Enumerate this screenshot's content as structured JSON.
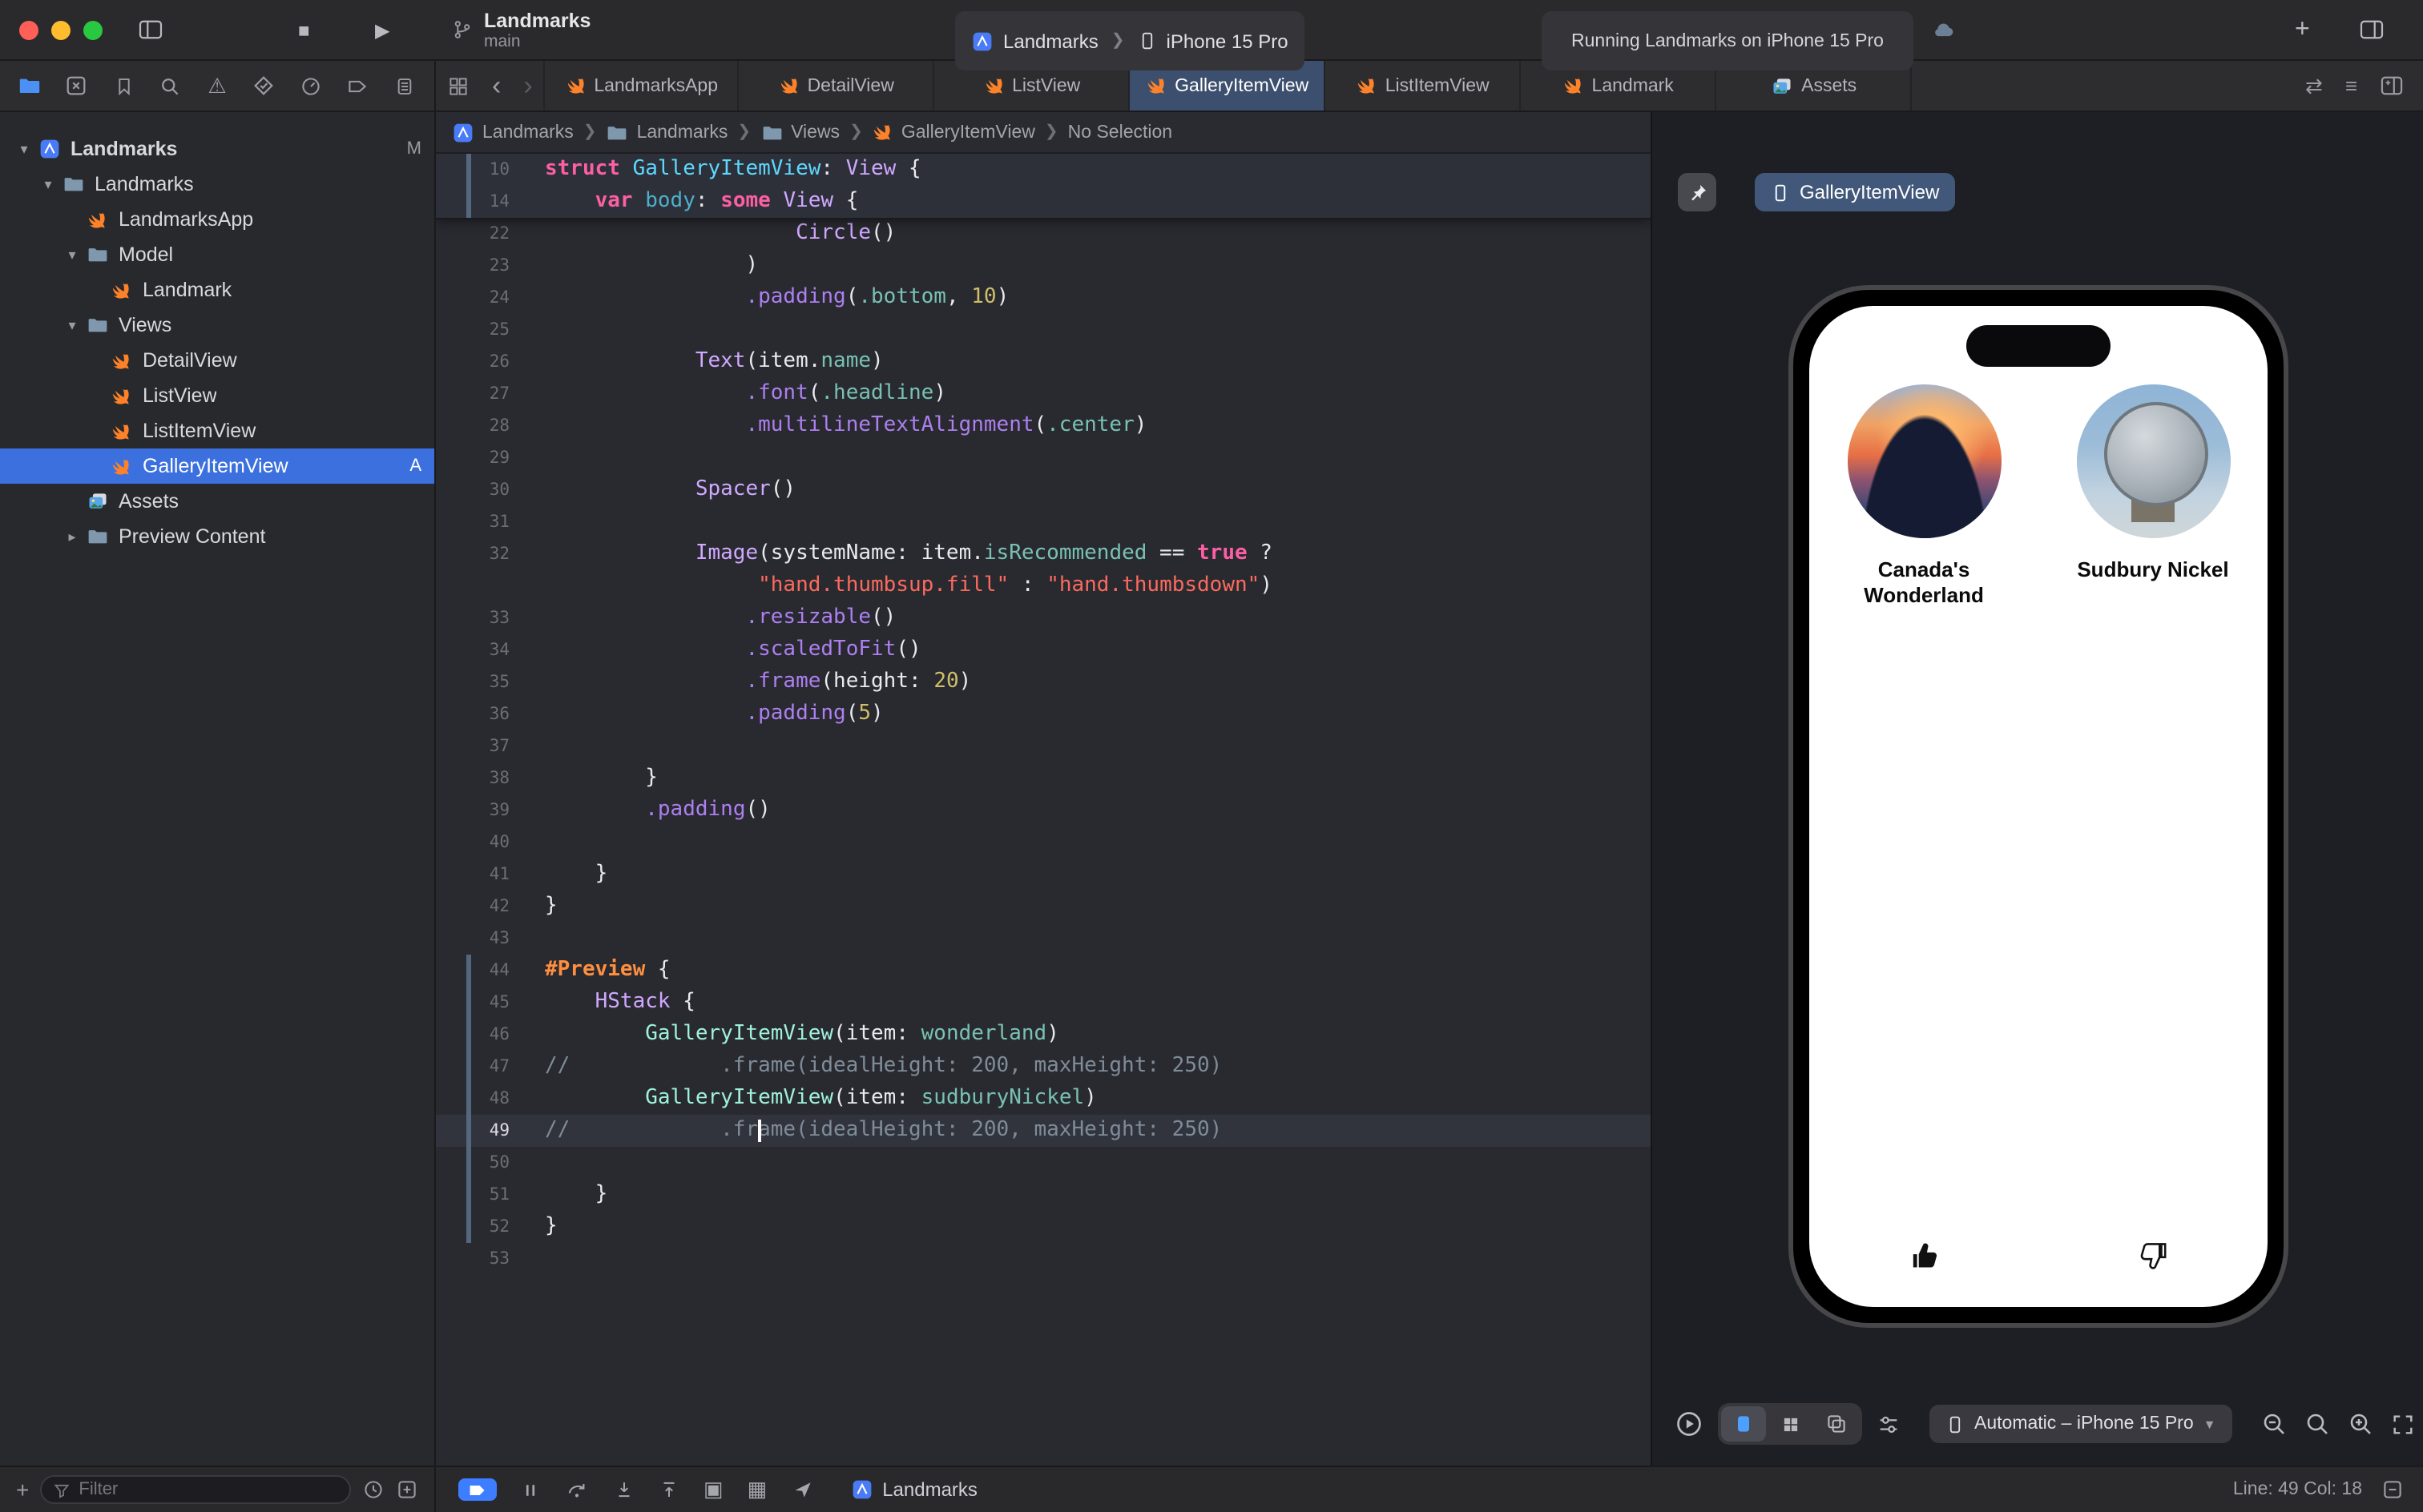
{
  "titlebar": {
    "title": "Landmarks",
    "subtitle": "main",
    "scheme_project": "Landmarks",
    "scheme_device": "iPhone 15 Pro",
    "status": "Running Landmarks on iPhone 15 Pro"
  },
  "navigator": {
    "icons": [
      {
        "name": "project-navigator",
        "icon": "folderC",
        "active": true
      },
      {
        "name": "source-control-navigator",
        "icon": "xsquare"
      },
      {
        "name": "bookmarks-navigator",
        "icon": "bookmark"
      },
      {
        "name": "find-navigator",
        "icon": "search"
      },
      {
        "name": "issues-navigator",
        "icon": "warning"
      },
      {
        "name": "tests-navigator",
        "icon": "diamond"
      },
      {
        "name": "debug-navigator",
        "icon": "gauge"
      },
      {
        "name": "breakpoints-navigator",
        "icon": "tag"
      },
      {
        "name": "reports-navigator",
        "icon": "doclist"
      }
    ]
  },
  "tabs": [
    {
      "label": "LandmarksApp",
      "icon": "swift"
    },
    {
      "label": "DetailView",
      "icon": "swift"
    },
    {
      "label": "ListView",
      "icon": "swift"
    },
    {
      "label": "GalleryItemView",
      "icon": "swift",
      "active": true
    },
    {
      "label": "ListItemView",
      "icon": "swift"
    },
    {
      "label": "Landmark",
      "icon": "swift"
    },
    {
      "label": "Assets",
      "icon": "assets"
    }
  ],
  "breadcrumb": [
    {
      "label": "Landmarks",
      "icon": "app"
    },
    {
      "label": "Landmarks",
      "icon": "folder"
    },
    {
      "label": "Views",
      "icon": "folder"
    },
    {
      "label": "GalleryItemView",
      "icon": "swift"
    },
    {
      "label": "No Selection"
    }
  ],
  "sidebar": {
    "items": [
      {
        "label": "Landmarks",
        "icon": "app",
        "level": 0,
        "chevron": "down",
        "badge": "M",
        "bold": true
      },
      {
        "label": "Landmarks",
        "icon": "folder",
        "level": 1,
        "chevron": "down"
      },
      {
        "label": "LandmarksApp",
        "icon": "swift",
        "level": 2
      },
      {
        "label": "Model",
        "icon": "folder",
        "level": 2,
        "chevron": "down"
      },
      {
        "label": "Landmark",
        "icon": "swift",
        "level": 3
      },
      {
        "label": "Views",
        "icon": "folder",
        "level": 2,
        "chevron": "down"
      },
      {
        "label": "DetailView",
        "icon": "swift",
        "level": 3
      },
      {
        "label": "ListView",
        "icon": "swift",
        "level": 3
      },
      {
        "label": "ListItemView",
        "icon": "swift",
        "level": 3
      },
      {
        "label": "GalleryItemView",
        "icon": "swift",
        "level": 3,
        "selected": true,
        "badge": "A"
      },
      {
        "label": "Assets",
        "icon": "assets",
        "level": 2
      },
      {
        "label": "Preview Content",
        "icon": "folder",
        "level": 2,
        "chevron": "right"
      }
    ],
    "filter_placeholder": "Filter"
  },
  "editor": {
    "sticky_lines": [
      {
        "num": "10",
        "chg": true,
        "segs": [
          [
            "struct ",
            "k"
          ],
          [
            "GalleryItemView",
            "d"
          ],
          [
            ": ",
            "w"
          ],
          [
            "View",
            "t"
          ],
          [
            " {",
            "w"
          ]
        ]
      },
      {
        "num": "14",
        "chg": true,
        "segs": [
          [
            "    ",
            "w"
          ],
          [
            "var",
            "k"
          ],
          [
            " ",
            "w"
          ],
          [
            "body",
            "v"
          ],
          [
            ": ",
            "w"
          ],
          [
            "some",
            "k"
          ],
          [
            " ",
            "w"
          ],
          [
            "View",
            "t"
          ],
          [
            " {",
            "w"
          ]
        ]
      }
    ],
    "lines": [
      {
        "num": "22",
        "segs": [
          [
            "                    ",
            "w"
          ],
          [
            "Circle",
            "t"
          ],
          [
            "()",
            "w"
          ]
        ]
      },
      {
        "num": "23",
        "segs": [
          [
            "                )",
            "w"
          ]
        ]
      },
      {
        "num": "24",
        "segs": [
          [
            "                ",
            "w"
          ],
          [
            ".padding",
            "fn"
          ],
          [
            "(",
            "w"
          ],
          [
            ".bottom",
            "p"
          ],
          [
            ", ",
            "w"
          ],
          [
            "10",
            "n"
          ],
          [
            ")",
            "w"
          ]
        ]
      },
      {
        "num": "25",
        "segs": []
      },
      {
        "num": "26",
        "segs": [
          [
            "            ",
            "w"
          ],
          [
            "Text",
            "t"
          ],
          [
            "(item.",
            "w"
          ],
          [
            "name",
            "p"
          ],
          [
            ")",
            "w"
          ]
        ]
      },
      {
        "num": "27",
        "segs": [
          [
            "                ",
            "w"
          ],
          [
            ".font",
            "fn"
          ],
          [
            "(",
            "w"
          ],
          [
            ".headline",
            "p"
          ],
          [
            ")",
            "w"
          ]
        ]
      },
      {
        "num": "28",
        "segs": [
          [
            "                ",
            "w"
          ],
          [
            ".multilineTextAlignment",
            "fn"
          ],
          [
            "(",
            "w"
          ],
          [
            ".center",
            "p"
          ],
          [
            ")",
            "w"
          ]
        ]
      },
      {
        "num": "29",
        "segs": []
      },
      {
        "num": "30",
        "segs": [
          [
            "            ",
            "w"
          ],
          [
            "Spacer",
            "t"
          ],
          [
            "()",
            "w"
          ]
        ]
      },
      {
        "num": "31",
        "segs": []
      },
      {
        "num": "32",
        "segs": [
          [
            "            ",
            "w"
          ],
          [
            "Image",
            "t"
          ],
          [
            "(systemName: item.",
            "w"
          ],
          [
            "isRecommended",
            "p"
          ],
          [
            " == ",
            "w"
          ],
          [
            "true",
            "k"
          ],
          [
            " ?",
            "w"
          ]
        ]
      },
      {
        "num": "",
        "segs": [
          [
            "                 ",
            "w"
          ],
          [
            "\"hand.thumbsup.fill\"",
            "s"
          ],
          [
            " : ",
            "w"
          ],
          [
            "\"hand.thumbsdown\"",
            "s"
          ],
          [
            ")",
            "w"
          ]
        ]
      },
      {
        "num": "33",
        "segs": [
          [
            "                ",
            "w"
          ],
          [
            ".resizable",
            "fn"
          ],
          [
            "()",
            "w"
          ]
        ]
      },
      {
        "num": "34",
        "segs": [
          [
            "                ",
            "w"
          ],
          [
            ".scaledToFit",
            "fn"
          ],
          [
            "()",
            "w"
          ]
        ]
      },
      {
        "num": "35",
        "segs": [
          [
            "                ",
            "w"
          ],
          [
            ".frame",
            "fn"
          ],
          [
            "(height: ",
            "w"
          ],
          [
            "20",
            "n"
          ],
          [
            ")",
            "w"
          ]
        ]
      },
      {
        "num": "36",
        "segs": [
          [
            "                ",
            "w"
          ],
          [
            ".padding",
            "fn"
          ],
          [
            "(",
            "w"
          ],
          [
            "5",
            "n"
          ],
          [
            ")",
            "w"
          ]
        ]
      },
      {
        "num": "37",
        "segs": []
      },
      {
        "num": "38",
        "segs": [
          [
            "        }",
            "w"
          ]
        ]
      },
      {
        "num": "39",
        "segs": [
          [
            "        ",
            "w"
          ],
          [
            ".padding",
            "fn"
          ],
          [
            "()",
            "w"
          ]
        ]
      },
      {
        "num": "40",
        "segs": []
      },
      {
        "num": "41",
        "segs": [
          [
            "    }",
            "w"
          ]
        ]
      },
      {
        "num": "42",
        "segs": [
          [
            "}",
            "w"
          ]
        ]
      },
      {
        "num": "43",
        "segs": []
      },
      {
        "num": "44",
        "chg": true,
        "segs": [
          [
            "#Preview",
            "m"
          ],
          [
            " {",
            "w"
          ]
        ]
      },
      {
        "num": "45",
        "chg": true,
        "segs": [
          [
            "    ",
            "w"
          ],
          [
            "HStack",
            "t"
          ],
          [
            " {",
            "w"
          ]
        ]
      },
      {
        "num": "46",
        "chg": true,
        "segs": [
          [
            "        ",
            "w"
          ],
          [
            "GalleryItemView",
            "pt"
          ],
          [
            "(item: ",
            "w"
          ],
          [
            "wonderland",
            "p"
          ],
          [
            ")",
            "w"
          ]
        ]
      },
      {
        "num": "47",
        "chg": true,
        "segs": [
          [
            "//            .frame(idealHeight: 200, maxHeight: 250)",
            "c"
          ]
        ]
      },
      {
        "num": "48",
        "chg": true,
        "segs": [
          [
            "        ",
            "w"
          ],
          [
            "GalleryItemView",
            "pt"
          ],
          [
            "(item: ",
            "w"
          ],
          [
            "sudburyNickel",
            "p"
          ],
          [
            ")",
            "w"
          ]
        ]
      },
      {
        "num": "49",
        "chg": true,
        "cur": true,
        "segs": [
          [
            "//            .frame(idealHeight: 200, maxHeight: 250)",
            "c"
          ]
        ]
      },
      {
        "num": "50",
        "chg": true,
        "segs": []
      },
      {
        "num": "51",
        "chg": true,
        "segs": [
          [
            "    }",
            "w"
          ]
        ]
      },
      {
        "num": "52",
        "chg": true,
        "segs": [
          [
            "}",
            "w"
          ]
        ]
      },
      {
        "num": "53",
        "segs": []
      }
    ]
  },
  "canvas": {
    "chip_label": "GalleryItemView",
    "items": [
      {
        "name": "Canada's Wonderland",
        "image": "wonderland",
        "thumb": "up-filled"
      },
      {
        "name": "Sudbury Nickel",
        "image": "nickel",
        "thumb": "down-outline"
      }
    ],
    "device_selector": "Automatic – iPhone 15 Pro"
  },
  "debugbar": {
    "process": "Landmarks",
    "line_col": "Line: 49  Col: 18"
  }
}
